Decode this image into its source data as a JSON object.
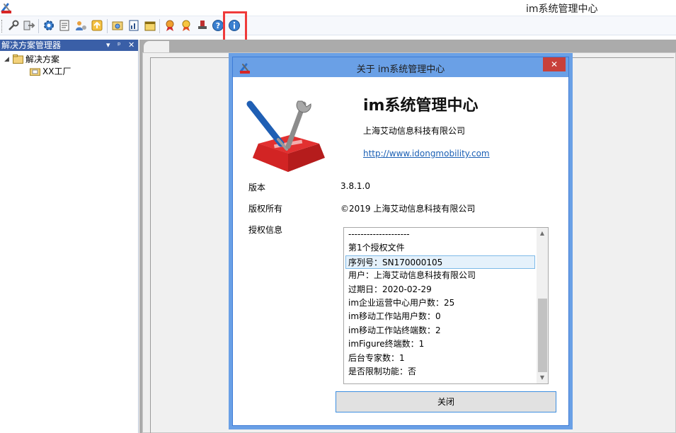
{
  "window": {
    "title": "im系统管理中心"
  },
  "toolbar": {
    "buttons": [
      {
        "icon": "wrench-plug-icon"
      },
      {
        "icon": "exit-icon"
      },
      {
        "icon": "gear-icon"
      },
      {
        "icon": "document-list-icon"
      },
      {
        "icon": "user-settings-icon"
      },
      {
        "icon": "upload-icon"
      },
      {
        "icon": "image-folder-icon"
      },
      {
        "icon": "report-icon"
      },
      {
        "icon": "calendar-icon"
      },
      {
        "icon": "ribbon-award-icon"
      },
      {
        "icon": "ribbon-gold-icon"
      },
      {
        "icon": "stamp-icon"
      },
      {
        "icon": "help-icon"
      },
      {
        "icon": "info-icon"
      }
    ]
  },
  "sidebar": {
    "title": "解决方案管理器",
    "controls": {
      "dropdown": "▾",
      "pin": "ᵖ",
      "close": "✕"
    },
    "tree": {
      "root": {
        "toggle": "◢",
        "label": "解决方案"
      },
      "child": {
        "label": "XX工厂"
      }
    }
  },
  "dialog": {
    "title": "关于 im系统管理中心",
    "close_glyph": "✕",
    "product_name": "im系统管理中心",
    "company": "上海艾动信息科技有限公司",
    "url": "http://www.idongmobility.com",
    "version_label": "版本",
    "version_value": "3.8.1.0",
    "copyright_label": "版权所有",
    "copyright_value": "©2019 上海艾动信息科技有限公司",
    "license_label": "授权信息",
    "license_lines": [
      "--------------------",
      "第1个授权文件",
      "序列号：SN170000105",
      "用户：上海艾动信息科技有限公司",
      "过期日：2020-02-29",
      "im企业运营中心用户数：25",
      "im移动工作站用户数：0",
      "im移动工作站终端数：2",
      "imFigure终端数：1",
      "后台专家数：1",
      "是否限制功能：否"
    ],
    "license_selected_index": 2,
    "close_button_label": "关闭",
    "scroll_up": "▲",
    "scroll_down": "▼"
  },
  "colors": {
    "accent": "#3a5fa7",
    "dialog_title_bar": "#6aa0e6",
    "close_red": "#c8403a",
    "highlight_box": "#ef3a3a",
    "link": "#1a5fb4"
  }
}
